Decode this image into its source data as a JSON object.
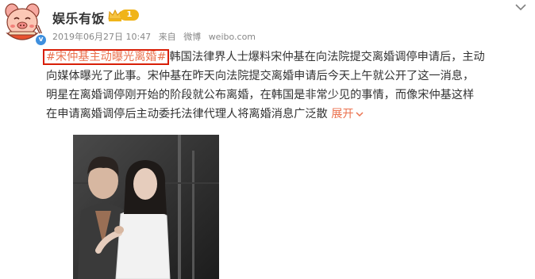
{
  "header": {
    "user_name": "娱乐有饭",
    "vip_level": "1",
    "timestamp": "2019年06月27日 10:47",
    "source_label": "来自",
    "source_app": "微博",
    "source_site": "weibo.com"
  },
  "post": {
    "hashtag": "#宋仲基主动曝光离婚#",
    "lines": [
      "韩国法律界人士爆料宋仲基在向法院提交离婚调停申请后，主动",
      "向媒体曝光了此事。宋仲基在昨天向法院提交离婚申请后今天上午就公开了这一消息，",
      "明星在离婚调停刚开始的阶段就公布离婚，在韩国是非常少见的事情，而像宋仲基这样",
      "在申请离婚调停后主动委托法律代理人将离婚消息广泛散"
    ],
    "expand_label": "展开"
  },
  "icons": {
    "avatar": "cartoon-pig-avatar",
    "verified": "verified-badge-icon",
    "vip": "crown-icon",
    "more": "chevron-down-icon"
  },
  "colors": {
    "hashtag": "#eb7350",
    "highlight_border": "#d81e06",
    "meta_text": "#888888",
    "vip_gold": "#f0b419",
    "verified_blue": "#3e8fde"
  }
}
